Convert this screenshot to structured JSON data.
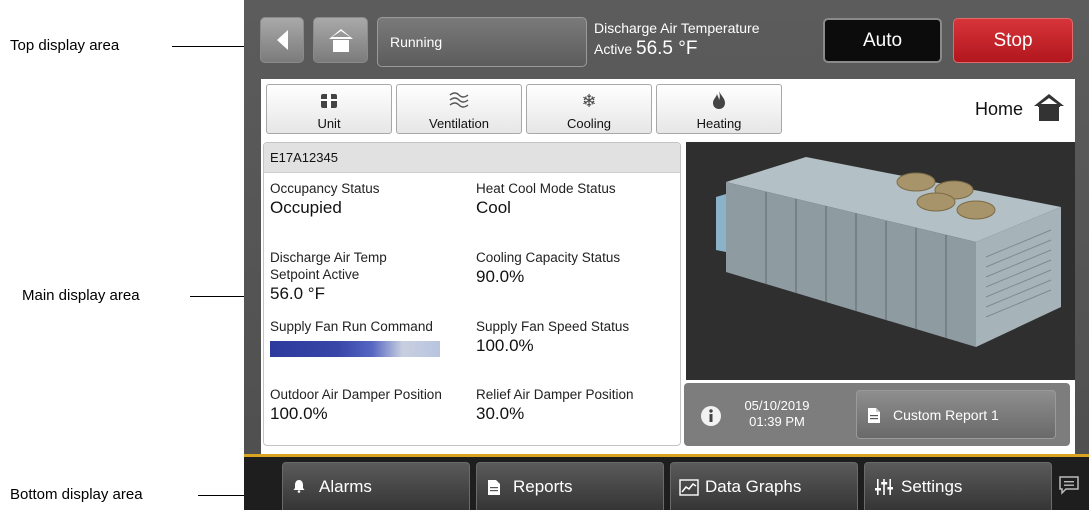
{
  "callouts": {
    "top": "Top display area",
    "main": "Main display area",
    "bottom": "Bottom display area"
  },
  "topbar": {
    "back_icon": "back-arrow-icon",
    "home_icon": "home-icon",
    "status": "Running",
    "dat_title": "Discharge Air Temperature",
    "dat_active_label": "Active",
    "dat_value": "56.5 °F",
    "auto_label": "Auto",
    "stop_label": "Stop",
    "colors": {
      "stop": "#c2242a",
      "auto": "#0c0c0c"
    }
  },
  "tabs": [
    {
      "label": "Unit",
      "icon": "unit-icon"
    },
    {
      "label": "Ventilation",
      "icon": "ventilation-icon"
    },
    {
      "label": "Cooling",
      "icon": "snowflake-icon"
    },
    {
      "label": "Heating",
      "icon": "flame-icon"
    }
  ],
  "home": {
    "label": "Home",
    "icon": "home-icon"
  },
  "unit": {
    "id": "E17A12345",
    "fields": {
      "occupancy": {
        "label": "Occupancy Status",
        "value": "Occupied"
      },
      "heat_cool": {
        "label": "Heat Cool Mode Status",
        "value": "Cool"
      },
      "dat_setpoint": {
        "label_line1": "Discharge Air Temp",
        "label_line2": "Setpoint Active",
        "value": "56.0 °F"
      },
      "cooling_capacity": {
        "label": "Cooling Capacity Status",
        "value": "90.0%"
      },
      "fan_run": {
        "label": "Supply Fan Run Command"
      },
      "fan_speed": {
        "label": "Supply Fan Speed Status",
        "value": "100.0%"
      },
      "oa_damper": {
        "label": "Outdoor Air Damper Position",
        "value": "100.0%"
      },
      "relief_damper": {
        "label": "Relief Air Damper Position",
        "value": "30.0%"
      }
    }
  },
  "info": {
    "icon": "info-icon",
    "date": "05/10/2019",
    "time": "01:39 PM",
    "report_label": "Custom Report 1",
    "report_icon": "document-icon"
  },
  "bottom_nav": [
    {
      "label": "Alarms",
      "icon": "bell-icon"
    },
    {
      "label": "Reports",
      "icon": "document-icon"
    },
    {
      "label": "Data Graphs",
      "icon": "chart-icon"
    },
    {
      "label": "Settings",
      "icon": "sliders-icon"
    }
  ],
  "chat_icon": "chat-icon",
  "accent": "#d9a422"
}
